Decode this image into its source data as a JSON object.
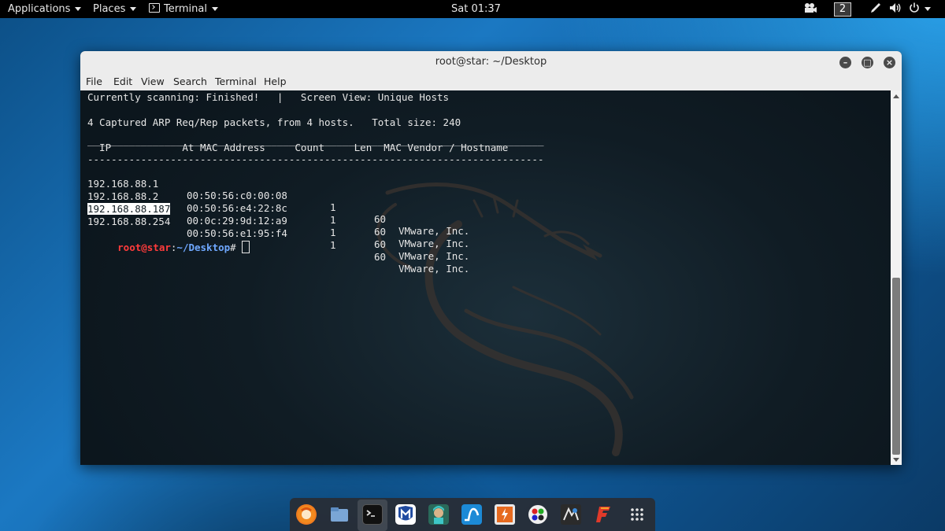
{
  "topbar": {
    "applications": "Applications",
    "places": "Places",
    "terminal_app": "Terminal",
    "clock": "Sat 01:37",
    "workspace": "2"
  },
  "window": {
    "title": "root@star: ~/Desktop",
    "menu": [
      "File",
      "Edit",
      "View",
      "Search",
      "Terminal",
      "Help"
    ]
  },
  "terminal": {
    "status_line": "Currently scanning: Finished!   |   Screen View: Unique Hosts",
    "summary_line": "4 Captured ARP Req/Rep packets, from 4 hosts.   Total size: 240",
    "header_rule": "_____________________________________________________________________________",
    "header": "  IP            At MAC Address     Count     Len  MAC Vendor / Hostname",
    "dash_rule": "-----------------------------------------------------------------------------",
    "rows": [
      {
        "ip": "192.168.88.1",
        "mac": "00:50:56:c0:00:08",
        "count": "1",
        "len": "60",
        "vendor": "VMware, Inc."
      },
      {
        "ip": "192.168.88.2",
        "mac": "00:50:56:e4:22:8c",
        "count": "1",
        "len": "60",
        "vendor": "VMware, Inc."
      },
      {
        "ip": "192.168.88.187",
        "mac": "00:0c:29:9d:12:a9",
        "count": "1",
        "len": "60",
        "vendor": "VMware, Inc."
      },
      {
        "ip": "192.168.88.254",
        "mac": "00:50:56:e1:95:f4",
        "count": "1",
        "len": "60",
        "vendor": "VMware, Inc."
      }
    ],
    "prompt_user": "root@star",
    "prompt_sep": ":",
    "prompt_path": "~/Desktop",
    "prompt_symbol": "#"
  },
  "dock": {
    "icons": [
      "firefox-icon",
      "files-icon",
      "terminal-icon",
      "metasploit-icon",
      "armitage-icon",
      "burpsuite-icon",
      "maltego-icon",
      "faraday-icon",
      "leafpad-icon",
      "flashfire-icon",
      "show-apps-icon"
    ]
  },
  "colors": {
    "prompt_user": "#ff3b3b",
    "prompt_path": "#6fa8ff",
    "terminal_bg": "#111d24"
  }
}
